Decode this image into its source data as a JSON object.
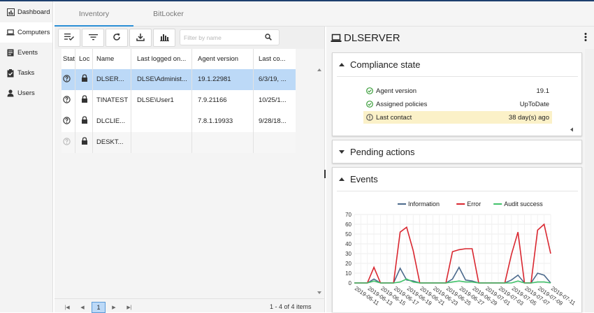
{
  "sidebar": {
    "items": [
      {
        "label": "Dashboard",
        "icon": "dashboard-icon"
      },
      {
        "label": "Computers",
        "icon": "laptop-icon"
      },
      {
        "label": "Events",
        "icon": "events-icon"
      },
      {
        "label": "Tasks",
        "icon": "tasks-icon"
      },
      {
        "label": "Users",
        "icon": "user-icon"
      }
    ],
    "active": "Computers"
  },
  "tabs": [
    {
      "label": "Inventory",
      "active": true
    },
    {
      "label": "BitLocker",
      "active": false
    }
  ],
  "toolbar": {
    "buttons": [
      "select-rows-icon",
      "filter-icon",
      "refresh-icon",
      "download-icon",
      "chart-icon"
    ],
    "filter_placeholder": "Filter by name"
  },
  "grid": {
    "columns": [
      "Stat",
      "Loc",
      "Name",
      "Last logged on...",
      "Agent version",
      "Last co..."
    ],
    "rows": [
      {
        "name": "DLSER...",
        "user": "DLSE\\Administ...",
        "agent": "19.1.22981",
        "last": "6/3/19, ...",
        "selected": true
      },
      {
        "name": "TINATEST",
        "user": "DLSE\\User1",
        "agent": "7.9.21166",
        "last": "10/25/1...",
        "selected": false
      },
      {
        "name": "DLCLIE...",
        "user": "",
        "agent": "7.8.1.19933",
        "last": "9/28/18...",
        "selected": false
      },
      {
        "name": "DESKT...",
        "user": "",
        "agent": "",
        "last": "",
        "selected": false
      }
    ]
  },
  "pager": {
    "page": "1",
    "info": "1 - 4 of 4 items"
  },
  "detail": {
    "title": "DLSERVER",
    "compliance": {
      "title": "Compliance state",
      "rows": [
        {
          "label": "Agent version",
          "value": "19.1",
          "status": "ok"
        },
        {
          "label": "Assigned policies",
          "value": "UpToDate",
          "status": "ok"
        },
        {
          "label": "Last contact",
          "value": "38 day(s) ago",
          "status": "warning"
        }
      ]
    },
    "pending": {
      "title": "Pending actions"
    },
    "events": {
      "title": "Events"
    }
  },
  "colors": {
    "accent": "#2b8fd6",
    "selected_row": "#bcd9f7",
    "ok": "#3a9d3a",
    "warning_bg": "#fbf1c8",
    "info_series": "#4c6a8c",
    "error_series": "#d9262f",
    "audit_series": "#41c26a"
  },
  "chart_data": {
    "type": "line",
    "title": "",
    "ylim": [
      0,
      70
    ],
    "yticks": [
      0,
      10,
      20,
      30,
      40,
      50,
      60,
      70
    ],
    "legend": "top",
    "x": [
      "2019-06-11",
      "2019-06-12",
      "2019-06-13",
      "2019-06-14",
      "2019-06-15",
      "2019-06-16",
      "2019-06-17",
      "2019-06-18",
      "2019-06-19",
      "2019-06-20",
      "2019-06-21",
      "2019-06-22",
      "2019-06-23",
      "2019-06-24",
      "2019-06-25",
      "2019-06-26",
      "2019-06-27",
      "2019-06-28",
      "2019-06-29",
      "2019-06-30",
      "2019-07-01",
      "2019-07-02",
      "2019-07-03",
      "2019-07-04",
      "2019-07-05",
      "2019-07-06",
      "2019-07-07",
      "2019-07-08",
      "2019-07-09",
      "2019-07-10",
      "2019-07-11"
    ],
    "xticklabels": [
      "2019-06-11",
      "2019-06-13",
      "2019-06-15",
      "2019-06-17",
      "2019-06-19",
      "2019-06-21",
      "2019-06-23",
      "2019-06-25",
      "2019-06-27",
      "2019-06-29",
      "2019-07-01",
      "2019-07-03",
      "2019-07-05",
      "2019-07-07",
      "2019-07-09",
      "2019-07-11"
    ],
    "series": [
      {
        "name": "Information",
        "color": "#4c6a8c",
        "values": [
          0,
          0,
          0,
          4,
          0,
          0,
          0,
          15,
          3,
          2,
          0,
          0,
          0,
          0,
          0,
          4,
          16,
          3,
          2,
          0,
          0,
          0,
          0,
          0,
          3,
          8,
          0,
          0,
          10,
          8,
          0
        ]
      },
      {
        "name": "Error",
        "color": "#d9262f",
        "values": [
          0,
          0,
          0,
          16,
          0,
          0,
          0,
          52,
          57,
          33,
          0,
          0,
          0,
          0,
          0,
          32,
          34,
          35,
          35,
          0,
          0,
          0,
          0,
          0,
          29,
          52,
          0,
          0,
          54,
          60,
          30
        ]
      },
      {
        "name": "Audit success",
        "color": "#41c26a",
        "values": [
          0,
          0,
          0,
          2,
          0,
          0,
          0,
          1,
          4,
          1,
          0,
          0,
          0,
          0,
          0,
          1,
          2,
          1,
          1,
          0,
          0,
          0,
          0,
          0,
          0,
          2,
          0,
          0,
          1,
          1,
          0
        ]
      }
    ]
  }
}
